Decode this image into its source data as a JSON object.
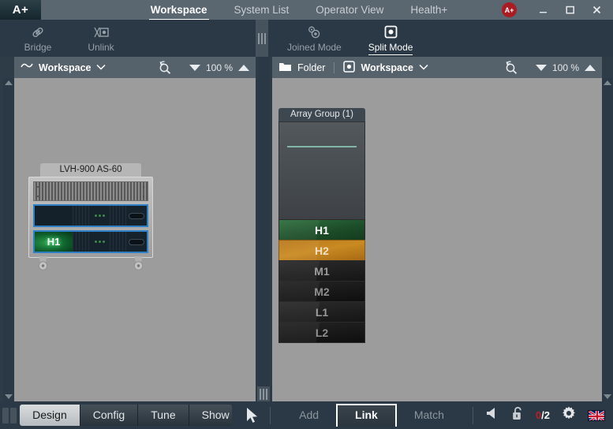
{
  "window": {
    "logo": "A+",
    "tabs": [
      {
        "label": "Workspace",
        "active": true
      },
      {
        "label": "System List",
        "active": false
      },
      {
        "label": "Operator View",
        "active": false
      },
      {
        "label": "Health+",
        "active": false
      }
    ],
    "avatar": "A+",
    "controls": {
      "minimize": "minimize-icon",
      "maximize": "maximize-icon",
      "close": "close-icon"
    }
  },
  "toolbar": {
    "left": [
      {
        "label": "Bridge",
        "icon": "link-icon",
        "active": false
      },
      {
        "label": "Unlink",
        "icon": "unlink-icon",
        "active": false
      }
    ],
    "right": [
      {
        "label": "Joined Mode",
        "icon": "joined-mode-icon",
        "active": false
      },
      {
        "label": "Split Mode",
        "icon": "split-mode-icon",
        "active": true
      }
    ]
  },
  "left_panel": {
    "header": {
      "view_label": "Workspace",
      "view_icon": "wave-icon",
      "chevron": "chevron-down-icon",
      "zoom_fit_icon": "zoom-fit-icon",
      "zoom_out_icon": "triangle-down-icon",
      "zoom_value": "100 %",
      "zoom_in_icon": "triangle-up-icon"
    },
    "device": {
      "name": "LVH-900 AS-60",
      "channels": [
        {
          "id": "",
          "lit": false
        },
        {
          "id": "H1",
          "lit": true
        }
      ]
    }
  },
  "right_panel": {
    "header": {
      "folder_label": "Folder",
      "folder_icon": "folder-icon",
      "view_label": "Workspace",
      "view_icon": "split-mode-icon",
      "chevron": "chevron-down-icon",
      "zoom_fit_icon": "zoom-fit-icon",
      "zoom_out_icon": "triangle-down-icon",
      "zoom_value": "100 %",
      "zoom_in_icon": "triangle-up-icon"
    },
    "array_group": {
      "title": "Array Group (1)",
      "elements": [
        {
          "label": "H1",
          "state": "green"
        },
        {
          "label": "H2",
          "state": "orange"
        },
        {
          "label": "M1",
          "state": "dark"
        },
        {
          "label": "M2",
          "state": "dark2"
        },
        {
          "label": "L1",
          "state": "dark"
        },
        {
          "label": "L2",
          "state": "dark2"
        }
      ]
    }
  },
  "bottom_bar": {
    "modes": [
      {
        "label": "Design",
        "active": true
      },
      {
        "label": "Config",
        "active": false
      },
      {
        "label": "Tune",
        "active": false
      },
      {
        "label": "Show",
        "active": false
      }
    ],
    "cursor_icon": "pointer-icon",
    "actions": [
      {
        "label": "Add",
        "active": false
      },
      {
        "label": "Link",
        "active": true
      },
      {
        "label": "Match",
        "active": false
      }
    ],
    "status": {
      "mute_icon": "speaker-icon",
      "lock_icon": "unlock-icon",
      "lock_count": "0",
      "lock_total": "/2",
      "settings_icon": "gear-icon",
      "language_icon": "uk-flag-icon"
    }
  },
  "colors": {
    "accent_red": "#a81c22",
    "titlebar": "#5a6670",
    "panel_bg": "#2b3845",
    "canvas": "#9c9c9c",
    "green_element": "#2f6f3d",
    "orange_element": "#c98a22"
  }
}
